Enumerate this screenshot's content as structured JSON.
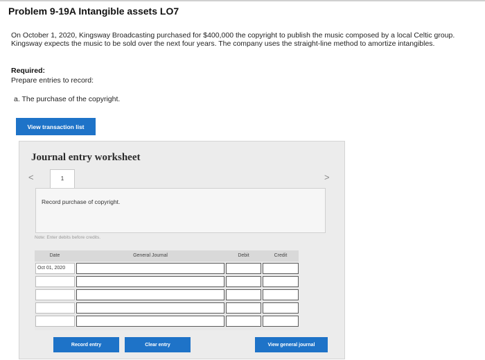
{
  "problem": {
    "title": "Problem 9-19A Intangible assets LO7",
    "intro": "On October 1, 2020, Kingsway Broadcasting purchased for $400,000 the copyright to publish the music composed by a local Celtic group. Kingsway expects the music to be sold over the next four years. The company uses the straight-line method to amortize intangibles.",
    "required_label": "Required:",
    "prepare_text": "Prepare entries to record:",
    "part_a": "a. The purchase of the copyright."
  },
  "buttons": {
    "view_transaction_list": "View transaction list",
    "record_entry": "Record entry",
    "clear_entry": "Clear entry",
    "view_general_journal": "View general journal"
  },
  "worksheet": {
    "title": "Journal entry worksheet",
    "prev_icon": "chevron-left-icon",
    "next_icon": "chevron-right-icon",
    "prev_glyph": "<",
    "next_glyph": ">",
    "current_tab": "1",
    "entry_description": "Record purchase of copyright.",
    "note": "Note: Enter debits before credits."
  },
  "journal": {
    "columns": [
      "Date",
      "General Journal",
      "Debit",
      "Credit"
    ],
    "rows": [
      {
        "date": "Oct 01, 2020",
        "account": "",
        "debit": "",
        "credit": ""
      },
      {
        "date": "",
        "account": "",
        "debit": "",
        "credit": ""
      },
      {
        "date": "",
        "account": "",
        "debit": "",
        "credit": ""
      },
      {
        "date": "",
        "account": "",
        "debit": "",
        "credit": ""
      },
      {
        "date": "",
        "account": "",
        "debit": "",
        "credit": ""
      }
    ]
  },
  "colors": {
    "primary_button": "#1e73c8",
    "worksheet_bg": "#ececec"
  }
}
